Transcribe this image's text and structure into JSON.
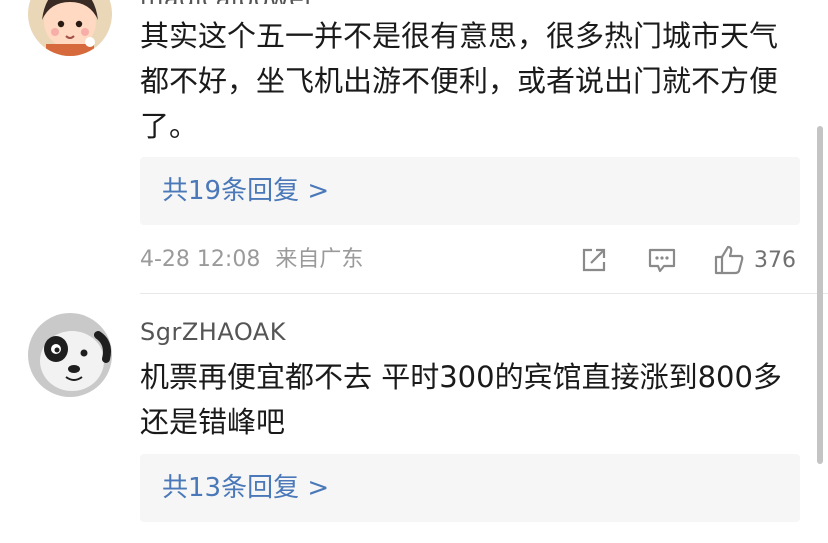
{
  "comments": [
    {
      "username": "magicalpower",
      "text": "其实这个五一并不是很有意思，很多热门城市天气都不好，坐飞机出游不便利，或者说出门就不方便了。",
      "reply_link": "共19条回复 >",
      "date": "4-28 12:08",
      "location": "来自广东",
      "actions": {
        "share_icon": "share-icon",
        "comment_icon": "comment-icon",
        "like_icon": "thumbs-up-icon",
        "like_count": "376"
      }
    },
    {
      "username": "SgrZHAOAK",
      "text": "机票再便宜都不去 平时300的宾馆直接涨到800多还是错峰吧",
      "reply_link": "共13条回复 >"
    }
  ],
  "colors": {
    "link": "#4a78b8",
    "text": "#1a1a1a",
    "meta": "#9a9a9a",
    "reply_bg": "#f6f6f6"
  }
}
